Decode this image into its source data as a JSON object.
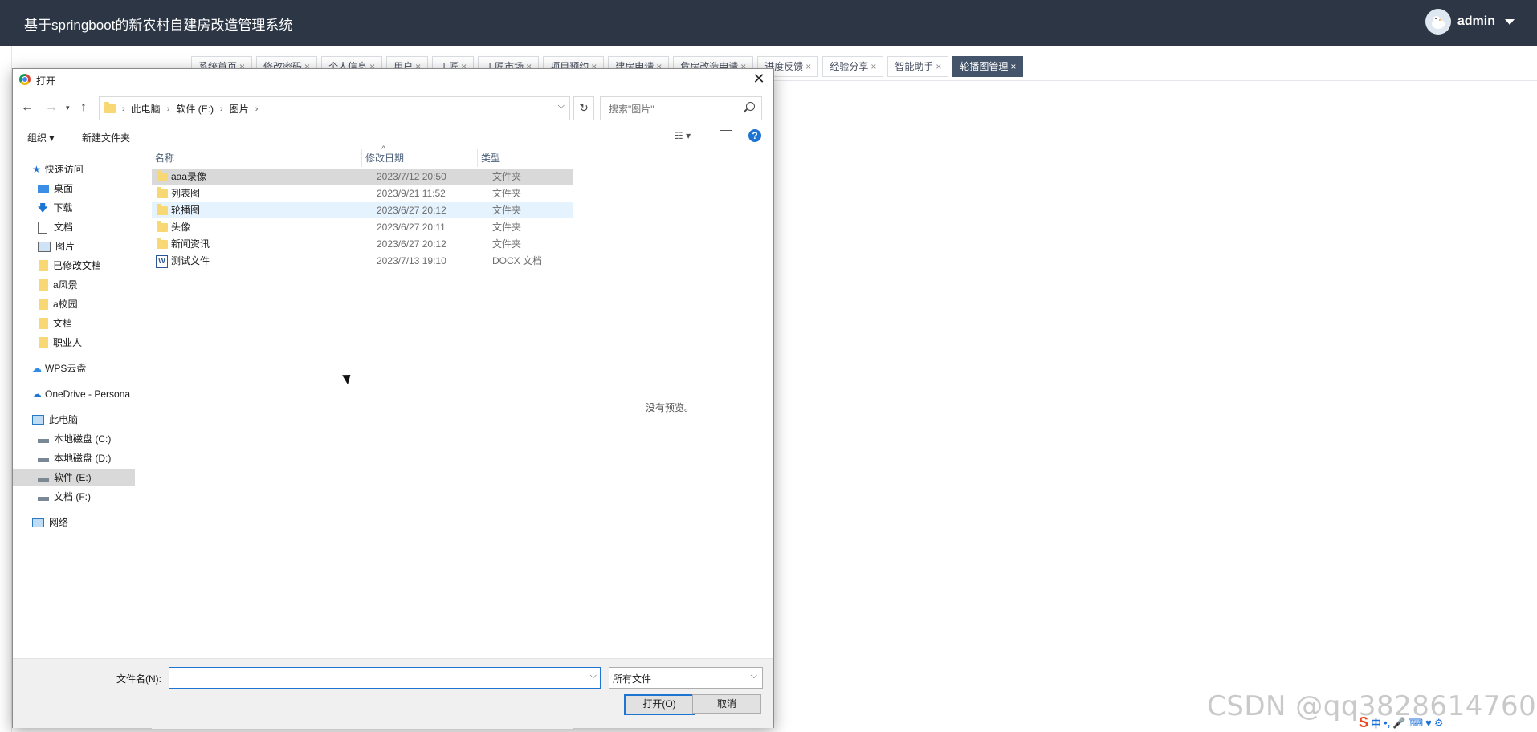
{
  "app": {
    "title": "基于springboot的新农村自建房改造管理系统",
    "user_name": "admin"
  },
  "tabs": [
    {
      "label": "系统首页",
      "active": false
    },
    {
      "label": "修改密码",
      "active": false
    },
    {
      "label": "个人信息",
      "active": false
    },
    {
      "label": "用户",
      "active": false
    },
    {
      "label": "工匠",
      "active": false
    },
    {
      "label": "工匠市场",
      "active": false
    },
    {
      "label": "项目预约",
      "active": false
    },
    {
      "label": "建房申请",
      "active": false
    },
    {
      "label": "危房改造申请",
      "active": false
    },
    {
      "label": "进度反馈",
      "active": false
    },
    {
      "label": "经验分享",
      "active": false
    },
    {
      "label": "智能助手",
      "active": false
    },
    {
      "label": "轮播图管理",
      "active": true
    }
  ],
  "dialog": {
    "title": "打开",
    "breadcrumb": [
      "此电脑",
      "软件 (E:)",
      "图片"
    ],
    "search_placeholder": "搜索\"图片\"",
    "toolbar": {
      "organize": "组织",
      "new_folder": "新建文件夹"
    },
    "nav": {
      "quick_access": "快速访问",
      "items": [
        {
          "label": "桌面",
          "pinned": true
        },
        {
          "label": "下载",
          "pinned": true
        },
        {
          "label": "文档",
          "pinned": true
        },
        {
          "label": "图片",
          "pinned": true
        },
        {
          "label": "已修改文档",
          "pinned": true
        },
        {
          "label": "a风景",
          "pinned": false
        },
        {
          "label": "a校园",
          "pinned": false
        },
        {
          "label": "文档",
          "pinned": false
        },
        {
          "label": "职业人",
          "pinned": false
        }
      ],
      "wps": "WPS云盘",
      "onedrive": "OneDrive - Persona",
      "this_pc": "此电脑",
      "drives": [
        "本地磁盘 (C:)",
        "本地磁盘 (D:)",
        "软件 (E:)",
        "文档 (F:)"
      ],
      "network": "网络"
    },
    "columns": {
      "name": "名称",
      "date": "修改日期",
      "type": "类型"
    },
    "files": [
      {
        "name": "aaa录像",
        "date": "2023/7/12 20:50",
        "type": "文件夹",
        "kind": "folder"
      },
      {
        "name": "列表图",
        "date": "2023/9/21 11:52",
        "type": "文件夹",
        "kind": "folder"
      },
      {
        "name": "轮播图",
        "date": "2023/6/27 20:12",
        "type": "文件夹",
        "kind": "folder"
      },
      {
        "name": "头像",
        "date": "2023/6/27 20:11",
        "type": "文件夹",
        "kind": "folder"
      },
      {
        "name": "新闻资讯",
        "date": "2023/6/27 20:12",
        "type": "文件夹",
        "kind": "folder"
      },
      {
        "name": "测试文件",
        "date": "2023/7/13 19:10",
        "type": "DOCX 文档",
        "kind": "docx"
      }
    ],
    "preview_text": "没有预览。",
    "filename_label": "文件名(N):",
    "filename_value": "",
    "filetype": "所有文件",
    "open_button": "打开(O)",
    "cancel_button": "取消"
  },
  "watermark": "CSDN @qq3828614760",
  "ime": {
    "mode": "中"
  }
}
